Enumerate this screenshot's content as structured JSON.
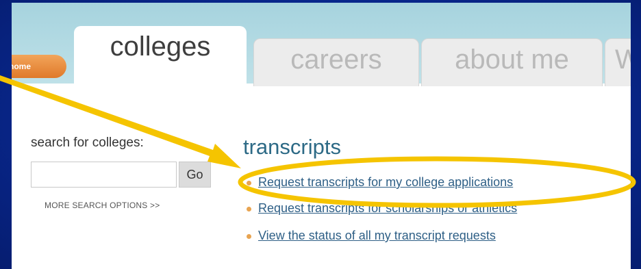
{
  "nav": {
    "home_label": "home",
    "tabs": [
      {
        "label": "colleges"
      },
      {
        "label": "careers"
      },
      {
        "label": "about me"
      },
      {
        "label": "W"
      }
    ]
  },
  "search": {
    "label": "search for colleges:",
    "input_value": "",
    "go_label": "Go",
    "more_options_label": "MORE SEARCH OPTIONS >>"
  },
  "transcripts": {
    "title": "transcripts",
    "links": [
      {
        "label": "Request transcripts for my college applications"
      },
      {
        "label": "Request transcripts for scholarships or athletics"
      },
      {
        "label": "View the status of all my transcript requests"
      }
    ]
  },
  "annotation": {
    "color": "#f5c400",
    "type": "arrow-and-ellipse"
  },
  "colors": {
    "slide_background": "#0a2a8c",
    "header_band": "#a6d3de",
    "home_tab": "#e0792a",
    "link": "#2e5f86",
    "bullet": "#e8a451"
  }
}
